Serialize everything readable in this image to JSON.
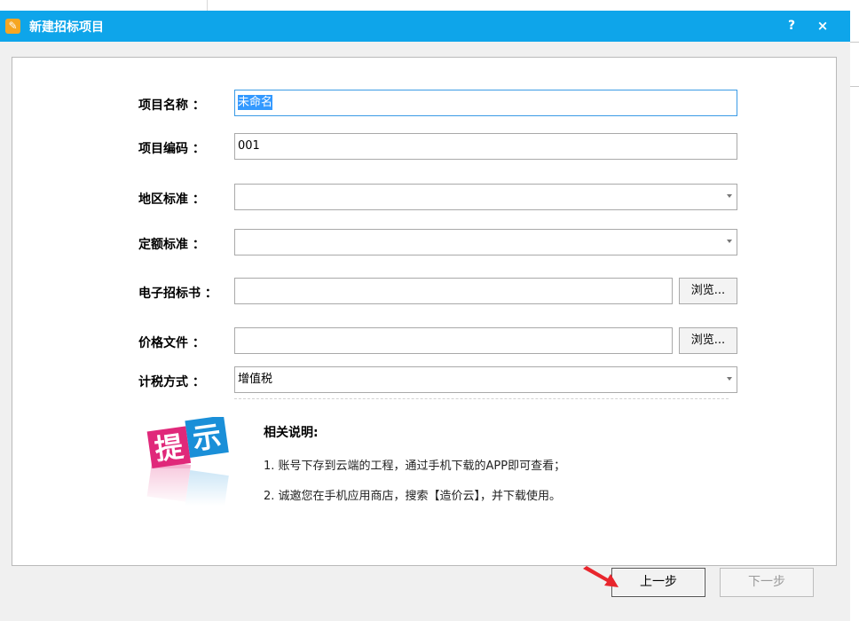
{
  "dialog": {
    "title": "新建招标项目",
    "help_label": "?",
    "close_label": "×"
  },
  "form": {
    "project_name": {
      "label": "项目名称 ：",
      "value": "未命名"
    },
    "project_code": {
      "label": "项目编码 ：",
      "value": "001"
    },
    "region_standard": {
      "label": "地区标准 ：",
      "value": ""
    },
    "quota_standard": {
      "label": "定额标准 ：",
      "value": ""
    },
    "tender_doc": {
      "label": "电子招标书 ：",
      "value": "",
      "browse_label": "浏览..."
    },
    "price_file": {
      "label": "价格文件 ：",
      "value": "",
      "browse_label": "浏览..."
    },
    "tax_method": {
      "label": "计税方式 ：",
      "value": "增值税"
    }
  },
  "tip": {
    "image_text_1": "提",
    "image_text_2": "示",
    "title": "相关说明:",
    "items": [
      "1. 账号下存到云端的工程，通过手机下载的APP即可查看；",
      "2. 诚邀您在手机应用商店，搜索【造价云】，并下载使用。"
    ]
  },
  "buttons": {
    "prev": "上一步",
    "next": "下一步"
  },
  "colors": {
    "titlebar": "#0ea5ea",
    "tip_pink": "#e0287a",
    "tip_blue": "#1a8fd8",
    "pointer_red": "#e8262d"
  }
}
